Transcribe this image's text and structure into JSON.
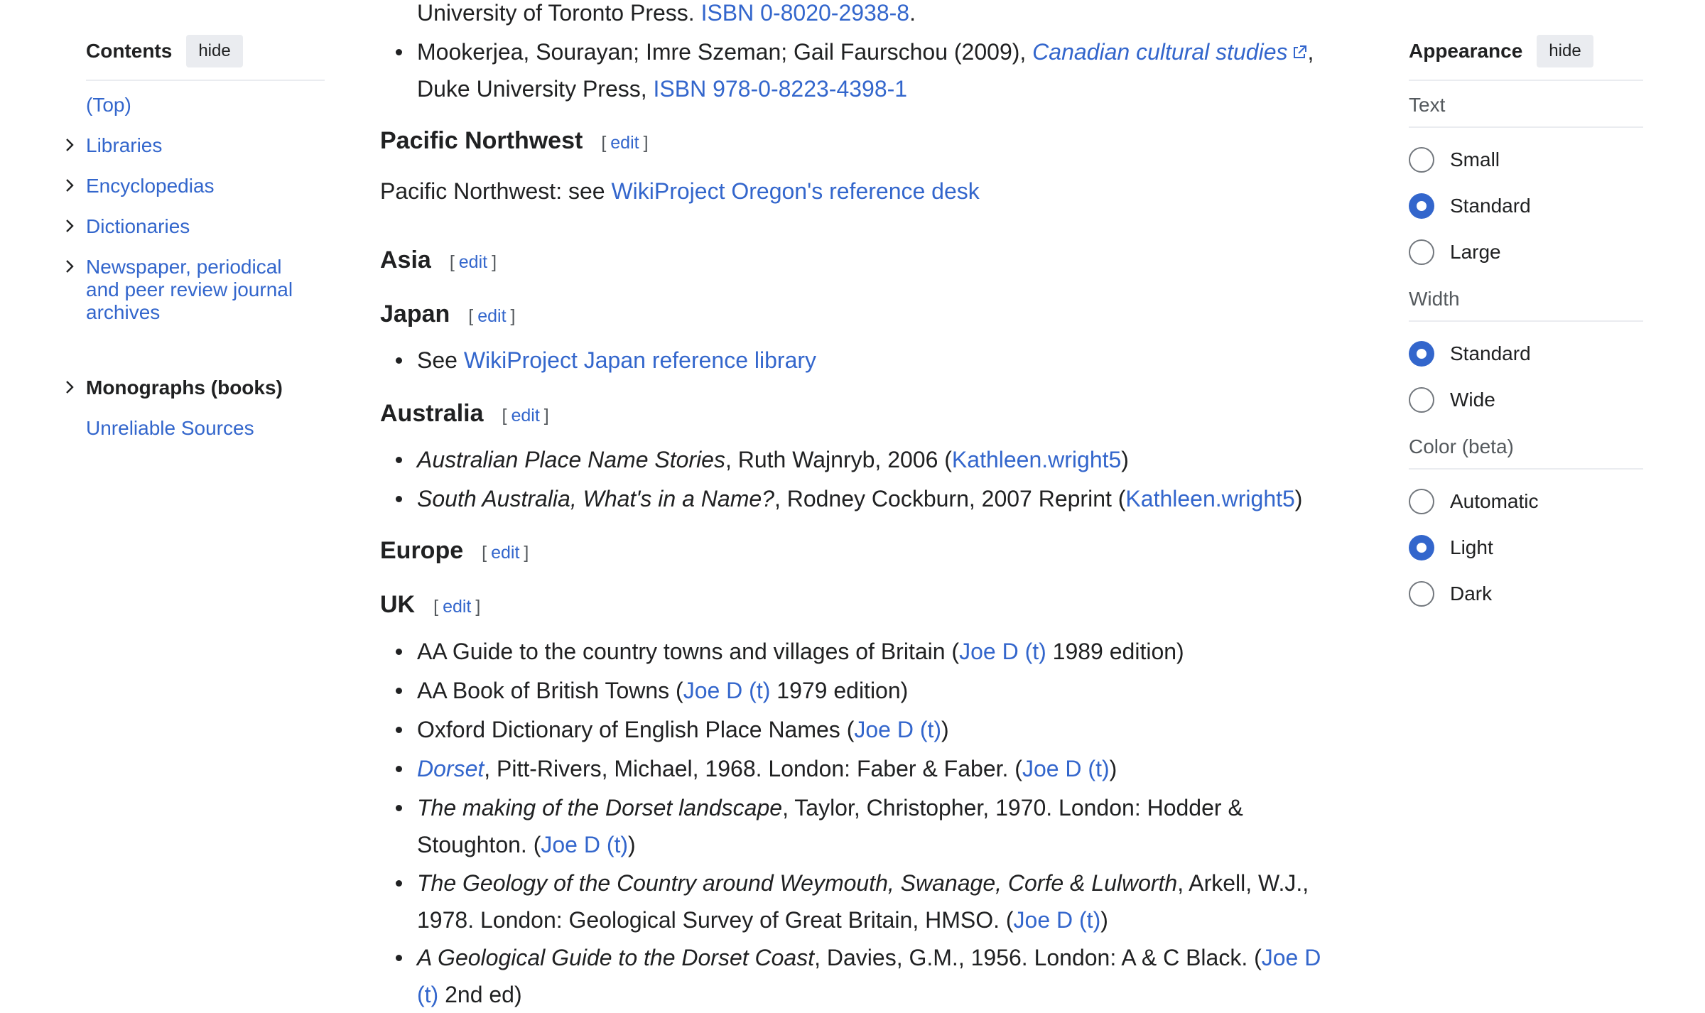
{
  "toc": {
    "title": "Contents",
    "hide_label": "hide",
    "items": [
      {
        "label": "(Top)",
        "chevron": false,
        "bold": false
      },
      {
        "label": "Libraries",
        "chevron": true,
        "bold": false
      },
      {
        "label": "Encyclopedias",
        "chevron": true,
        "bold": false
      },
      {
        "label": "Dictionaries",
        "chevron": true,
        "bold": false
      },
      {
        "label": "Newspaper, periodical and peer review journal archives",
        "chevron": true,
        "bold": false
      },
      {
        "label": "Monographs (books)",
        "chevron": true,
        "bold": true
      },
      {
        "label": "Unreliable Sources",
        "chevron": false,
        "bold": false
      }
    ]
  },
  "main": {
    "top_ref": {
      "text": "University of Toronto Press. ",
      "isbn": "ISBN 0-8020-2938-8",
      "end": "."
    },
    "mookerjea": {
      "text": "Mookerjea, Sourayan; Imre Szeman; Gail Faurschou (2009), ",
      "title": "Canadian cultural studies",
      "sep": ",",
      "line2": "Duke University Press, ",
      "isbn": "ISBN 978-0-8223-4398-1"
    },
    "edit_label": "edit",
    "pacific": {
      "heading": "Pacific Northwest",
      "text": "Pacific Northwest: see ",
      "link": "WikiProject Oregon's reference desk"
    },
    "asia": {
      "heading": "Asia"
    },
    "japan": {
      "heading": "Japan",
      "see": "See ",
      "link": "WikiProject Japan reference library"
    },
    "australia": {
      "heading": "Australia",
      "items": [
        {
          "title": "Australian Place Name Stories",
          "rest": ", Ruth Wajnryb, 2006 (",
          "user": "Kathleen.wright5",
          "end": ")"
        },
        {
          "title": "South Australia, What's in a Name?",
          "rest": ", Rodney Cockburn, 2007 Reprint (",
          "user": "Kathleen.wright5",
          "end": ")"
        }
      ]
    },
    "europe": {
      "heading": "Europe"
    },
    "uk": {
      "heading": "UK",
      "user": "Joe D",
      "talk": "(t)",
      "items": [
        {
          "pre": "AA Guide to the country towns and villages of Britain (",
          "post": " 1989 edition)"
        },
        {
          "pre": "AA Book of British Towns (",
          "post": " 1979 edition)"
        },
        {
          "pre": "Oxford Dictionary of English Place Names (",
          "post": ")"
        }
      ],
      "dorset": {
        "title": "Dorset",
        "rest": ", Pitt-Rivers, Michael, 1968. London: Faber & Faber. (",
        "end": ")"
      },
      "making": {
        "title": "The making of the Dorset landscape",
        "rest": ", Taylor, Christopher, 1970. London: Hodder &",
        "line2": "Stoughton. (",
        "end": ")"
      },
      "geology": {
        "title": "The Geology of the Country around Weymouth, Swanage, Corfe & Lulworth",
        "rest": ", Arkell, W.J.,",
        "line2": "1978. London: Geological Survey of Great Britain, HMSO. (",
        "end": ")"
      },
      "guide": {
        "title": "A Geological Guide to the Dorset Coast",
        "rest": ", Davies, G.M., 1956. London: A & C Black. (",
        "line2_end": " 2nd ed)"
      }
    }
  },
  "appearance": {
    "title": "Appearance",
    "hide_label": "hide",
    "text": {
      "label": "Text",
      "options": [
        "Small",
        "Standard",
        "Large"
      ],
      "selected": "Standard"
    },
    "width": {
      "label": "Width",
      "options": [
        "Standard",
        "Wide"
      ],
      "selected": "Standard"
    },
    "color": {
      "label": "Color (beta)",
      "options": [
        "Automatic",
        "Light",
        "Dark"
      ],
      "selected": "Light"
    }
  }
}
